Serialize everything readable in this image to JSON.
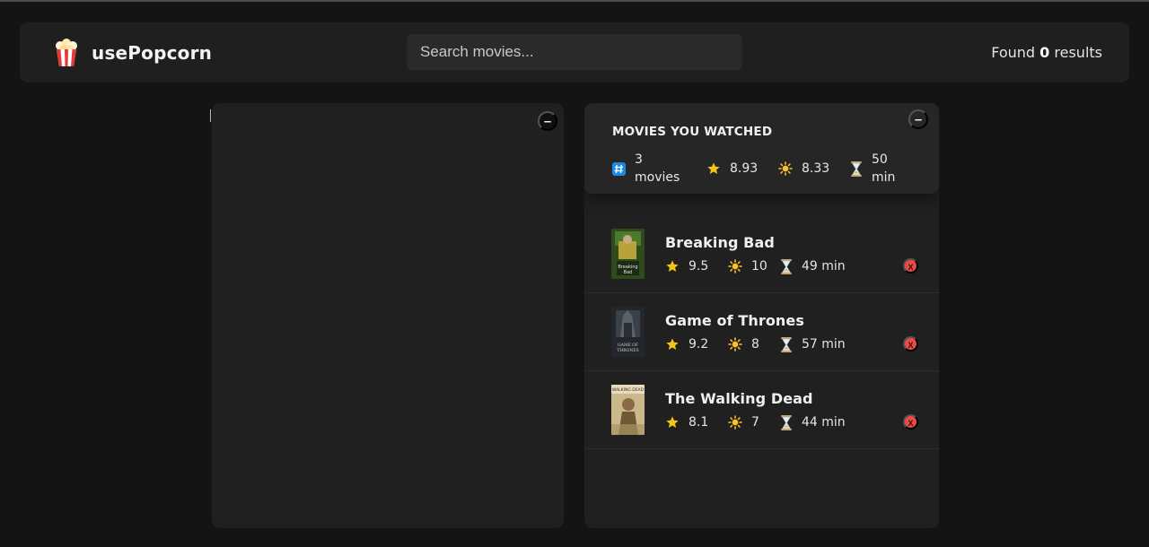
{
  "app": {
    "name": "usePopcorn",
    "logo_icon": "popcorn-icon"
  },
  "search": {
    "placeholder": "Search movies...",
    "value": ""
  },
  "results": {
    "prefix": "Found",
    "count": "0",
    "suffix": "results"
  },
  "left_box": {
    "toggle_label": "–"
  },
  "right_box": {
    "toggle_label": "–"
  },
  "summary": {
    "title": "MOVIES YOU WATCHED",
    "count_value": "3",
    "count_unit": "movies",
    "avg_imdb": "8.93",
    "avg_user": "8.33",
    "avg_runtime_value": "50",
    "avg_runtime_unit": "min"
  },
  "watched": [
    {
      "title": "Breaking Bad",
      "imdb": "9.5",
      "user": "10",
      "runtime": "49 min",
      "delete_label": "X"
    },
    {
      "title": "Game of Thrones",
      "imdb": "9.2",
      "user": "8",
      "runtime": "57 min",
      "delete_label": "X"
    },
    {
      "title": "The Walking Dead",
      "imdb": "8.1",
      "user": "7",
      "runtime": "44 min",
      "delete_label": "X"
    }
  ],
  "colors": {
    "background": "#141414",
    "panel": "#202020",
    "star": "#f5c518",
    "delete": "#f04747",
    "hash_badge": "#1e88e5"
  }
}
